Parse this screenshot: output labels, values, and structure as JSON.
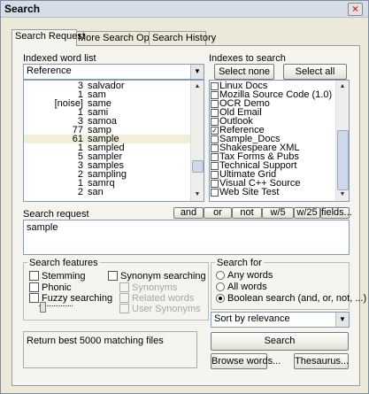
{
  "title": "Search",
  "close_glyph": "×",
  "tabs": [
    "Search Request",
    "More Search Options",
    "Search History"
  ],
  "indexed_word_list": {
    "label": "Indexed word list",
    "combo_value": "Reference",
    "rows": [
      {
        "count": "3",
        "word": "salvador"
      },
      {
        "count": "1",
        "word": "sam"
      },
      {
        "count": "[noise]",
        "word": "same"
      },
      {
        "count": "1",
        "word": "sami"
      },
      {
        "count": "3",
        "word": "samoa"
      },
      {
        "count": "77",
        "word": "samp"
      },
      {
        "count": "61",
        "word": "sample"
      },
      {
        "count": "1",
        "word": "sampled"
      },
      {
        "count": "5",
        "word": "sampler"
      },
      {
        "count": "3",
        "word": "samples"
      },
      {
        "count": "2",
        "word": "sampling"
      },
      {
        "count": "1",
        "word": "samrq"
      },
      {
        "count": "2",
        "word": "san"
      }
    ]
  },
  "indexes": {
    "label": "Indexes to search",
    "select_none": "Select none",
    "select_all": "Select all",
    "items": [
      {
        "name": "Linux Docs",
        "checked": false
      },
      {
        "name": "Mozilla Source Code (1.0)",
        "checked": false
      },
      {
        "name": "OCR Demo",
        "checked": false
      },
      {
        "name": "Old Email",
        "checked": false
      },
      {
        "name": "Outlook",
        "checked": false
      },
      {
        "name": "Reference",
        "checked": true
      },
      {
        "name": "Sample_Docs",
        "checked": false
      },
      {
        "name": "Shakespeare XML",
        "checked": false
      },
      {
        "name": "Tax Forms & Pubs",
        "checked": false
      },
      {
        "name": "Technical Support",
        "checked": false
      },
      {
        "name": "Ultimate Grid",
        "checked": false
      },
      {
        "name": "Visual C++ Source",
        "checked": false
      },
      {
        "name": "Web Site Test",
        "checked": false
      }
    ]
  },
  "search_request": {
    "label": "Search request",
    "value": "sample",
    "operators": [
      "and",
      "or",
      "not",
      "w/5",
      "w/25",
      "fields..."
    ]
  },
  "features": {
    "label": "Search features",
    "stemming": "Stemming",
    "phonic": "Phonic",
    "fuzzy": "Fuzzy searching",
    "synonym": "Synonym searching",
    "sub": [
      "Synonyms",
      "Related words",
      "User Synonyms"
    ]
  },
  "search_for": {
    "label": "Search for",
    "options": [
      "Any words",
      "All words",
      "Boolean search (and, or, not, ...)"
    ],
    "selected": 2
  },
  "sort": "Sort by relevance",
  "status": "Return best 5000 matching files",
  "actions": {
    "search": "Search",
    "browse": "Browse words...",
    "thesaurus": "Thesaurus..."
  }
}
